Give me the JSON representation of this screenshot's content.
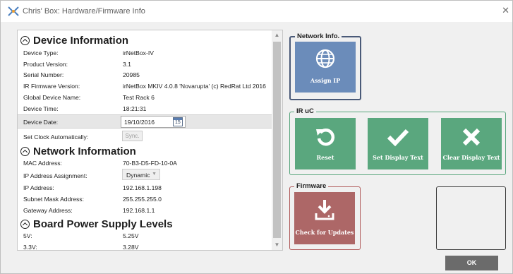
{
  "window": {
    "title": "Chris' Box: Hardware/Firmware Info",
    "close_glyph": "✕"
  },
  "device_info": {
    "heading": "Device Information",
    "rows": [
      {
        "label": "Device Type:",
        "value": "irNetBox-IV"
      },
      {
        "label": "Product Version:",
        "value": "3.1"
      },
      {
        "label": "Serial Number:",
        "value": "20985"
      },
      {
        "label": "IR Firmware Version:",
        "value": "irNetBox MKIV 4.0.8 'Novarupta' (c) RedRat Ltd 2016"
      },
      {
        "label": "Global Device Name:",
        "value": "Test Rack 6"
      },
      {
        "label": "Device Time:",
        "value": "18:21:31"
      }
    ],
    "device_date": {
      "label": "Device Date:",
      "value": "19/10/2016",
      "calendar_day": "15"
    },
    "set_clock": {
      "label": "Set Clock Automatically:",
      "button": "Sync."
    }
  },
  "network_info": {
    "heading": "Network Information",
    "mac": {
      "label": "MAC Address:",
      "value": "70-B3-D5-FD-10-0A"
    },
    "assignment": {
      "label": "IP Address Assignment:",
      "value": "Dynamic"
    },
    "rows": [
      {
        "label": "IP Address:",
        "value": "192.168.1.198"
      },
      {
        "label": "Subnet Mask Address:",
        "value": "255.255.255.0"
      },
      {
        "label": "Gateway Address:",
        "value": "192.168.1.1"
      }
    ]
  },
  "power": {
    "heading": "Board Power Supply Levels",
    "rows": [
      {
        "label": "5V:",
        "value": "5.25V"
      },
      {
        "label": "3.3V:",
        "value": "3.28V"
      }
    ]
  },
  "groups": {
    "network": {
      "label": "Network Info.",
      "assign_ip": "Assign IP"
    },
    "ir_uc": {
      "label": "IR uC",
      "reset": "Reset",
      "set_display_text": "Set Display Text",
      "clear_display_text": "Clear Display Text"
    },
    "firmware": {
      "label": "Firmware",
      "check_updates": "Check for Updates"
    }
  },
  "ok_button": "OK",
  "colors": {
    "network_tile": "#6b8cba",
    "ir_tile": "#5aa77e",
    "firmware_tile": "#ad6767",
    "network_border": "#4a5a78",
    "ir_border": "#5aa77e",
    "firmware_border": "#b05a5a"
  },
  "icons": [
    "app-icon",
    "globe-icon",
    "reset-icon",
    "check-icon",
    "cross-icon",
    "download-icon",
    "calendar-icon",
    "chevron-up-icon",
    "close-icon"
  ]
}
